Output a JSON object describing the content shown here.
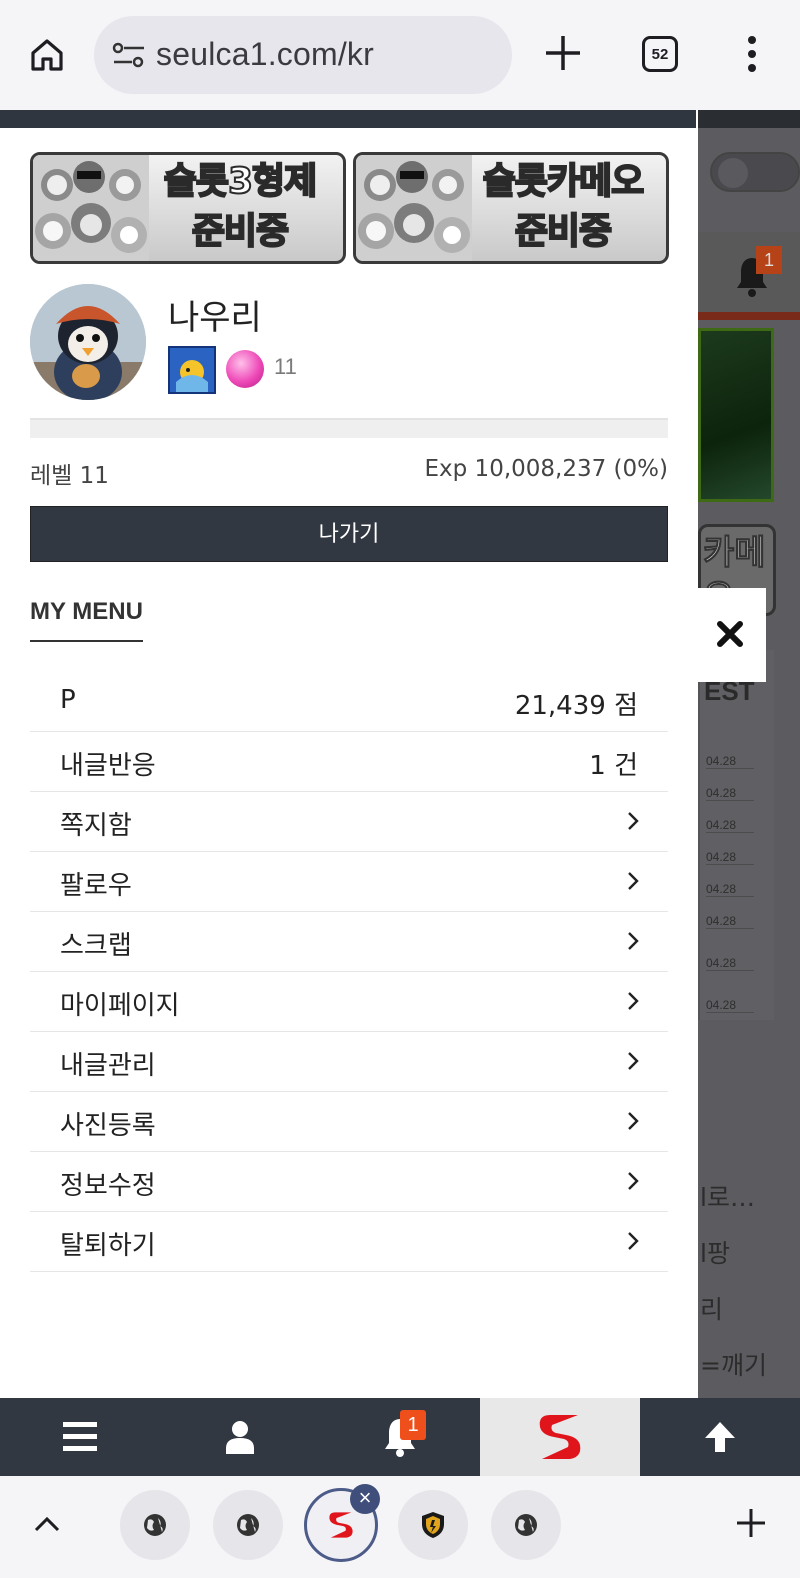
{
  "browser": {
    "url": "seulca1.com/kr",
    "tab_count": "52"
  },
  "drawer": {
    "banners": [
      {
        "line1": "슬롯3형제",
        "line2": "준비중"
      },
      {
        "line1": "슬롯카메오",
        "line2": "준비중"
      }
    ],
    "profile": {
      "nickname": "나우리",
      "level_number": "11",
      "level_label": "레벨 11",
      "exp_label": "Exp 10,008,237 (0%)",
      "exp_progress_percent": 0
    },
    "logout_label": "나가기",
    "menu_title": "MY MENU",
    "menu_items": [
      {
        "label": "P",
        "value": "21,439 점"
      },
      {
        "label": "내글반응",
        "value": "1 건"
      },
      {
        "label": "쪽지함",
        "value": ""
      },
      {
        "label": "팔로우",
        "value": ""
      },
      {
        "label": "스크랩",
        "value": ""
      },
      {
        "label": "마이페이지",
        "value": ""
      },
      {
        "label": "내글관리",
        "value": ""
      },
      {
        "label": "사진등록",
        "value": ""
      },
      {
        "label": "정보수정",
        "value": ""
      },
      {
        "label": "탈퇴하기",
        "value": ""
      }
    ]
  },
  "background_site": {
    "bell_badge": "1",
    "banner_text": "카메오\n준비",
    "best_label": "EST",
    "dates": [
      "04.28",
      "04.28",
      "04.28",
      "04.28",
      "04.28",
      "04.28",
      "04.28",
      "04.28"
    ],
    "side_texts": [
      "l로…",
      "l팡",
      "리",
      "=깨기"
    ]
  },
  "bottom_nav": {
    "notification_count": "1"
  },
  "colors": {
    "drawer_dark": "#313842",
    "badge_orange": "#ef4f1a",
    "site_red": "#e0151c"
  }
}
